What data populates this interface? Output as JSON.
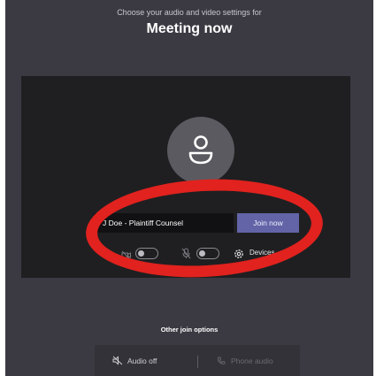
{
  "header": {
    "subtitle": "Choose your audio and video settings for",
    "title": "Meeting now"
  },
  "preview": {
    "avatar_icon": "person-icon",
    "name_value": "J Doe - Plaintiff Counsel",
    "join_label": "Join now"
  },
  "controls": {
    "camera": {
      "icon": "camera-off-icon",
      "state": "off"
    },
    "mic": {
      "icon": "mic-off-icon",
      "state": "off"
    },
    "devices": {
      "icon": "gear-icon",
      "label": "Devices"
    }
  },
  "other_options": {
    "label": "Other join options",
    "audio_off_label": "Audio off",
    "audio_off_icon": "speaker-off-icon",
    "phone_audio_label": "Phone audio",
    "phone_audio_icon": "phone-icon"
  },
  "annotation": {
    "color": "#e1221e"
  },
  "colors": {
    "background": "#3b3a42",
    "preview": "#1f1f21",
    "accent": "#6264a7"
  }
}
